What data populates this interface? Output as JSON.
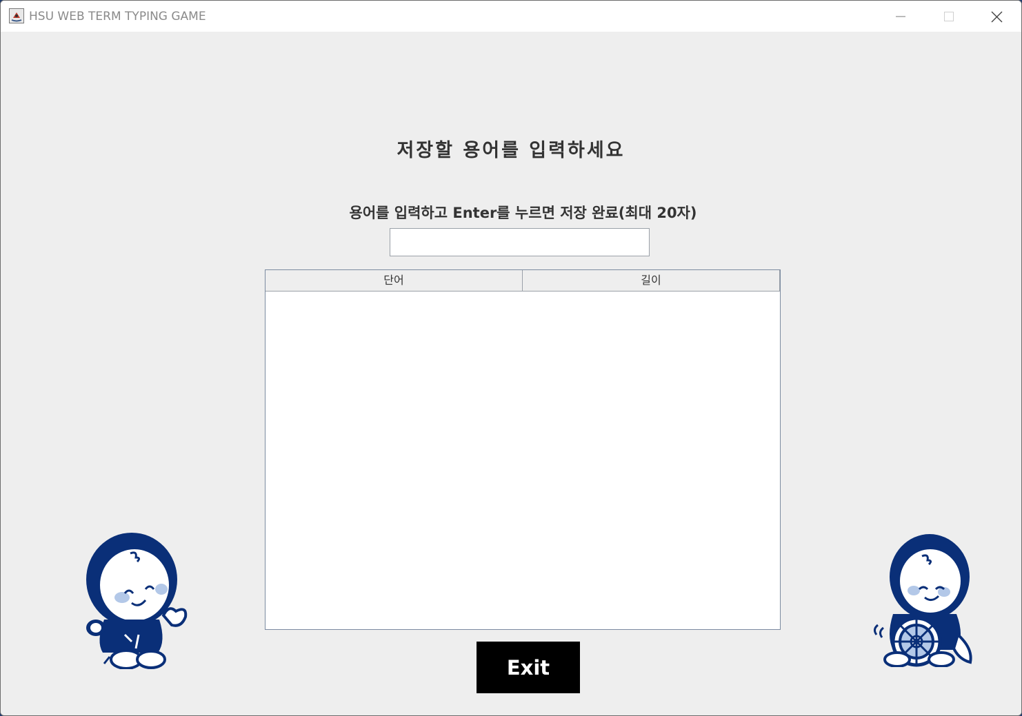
{
  "window": {
    "title": "HSU WEB TERM TYPING GAME",
    "app_icon": "java-icon",
    "controls": [
      "minimize-icon",
      "maximize-icon",
      "close-icon"
    ]
  },
  "page": {
    "heading": "저장할 용어를 입력하세요",
    "instruction": "용어를 입력하고 Enter를 누르면 저장 완료(최대 20자)",
    "input": {
      "value": "",
      "placeholder": ""
    },
    "table": {
      "columns": [
        "단어",
        "길이"
      ],
      "rows": []
    },
    "exit_label": "Exit"
  },
  "colors": {
    "background": "#eeeeee",
    "mascot_navy": "#0a2f78",
    "mascot_light": "#b3c8e8",
    "button": "#000000"
  }
}
